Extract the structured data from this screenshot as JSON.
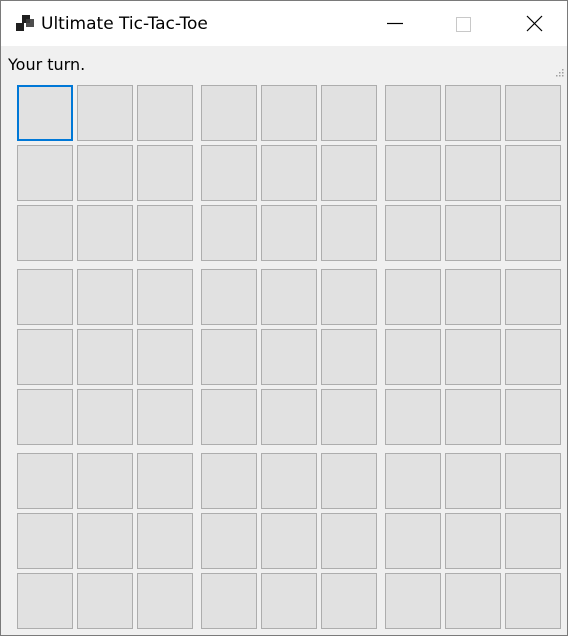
{
  "window": {
    "title": "Ultimate Tic-Tac-Toe"
  },
  "icons": {
    "app": "app-icon",
    "minimize": "minimize-icon",
    "maximize": "maximize-icon",
    "close": "close-icon",
    "grip": "resize-grip-icon"
  },
  "status": {
    "text": "Your turn."
  },
  "board": {
    "rows": 9,
    "columns": 9,
    "focused_cell": {
      "row": 0,
      "column": 0
    }
  },
  "colors": {
    "cell_fill": "#e1e1e1",
    "cell_border": "#adadad",
    "focus_border": "#0078d7",
    "client_background": "#f0f0f0"
  }
}
